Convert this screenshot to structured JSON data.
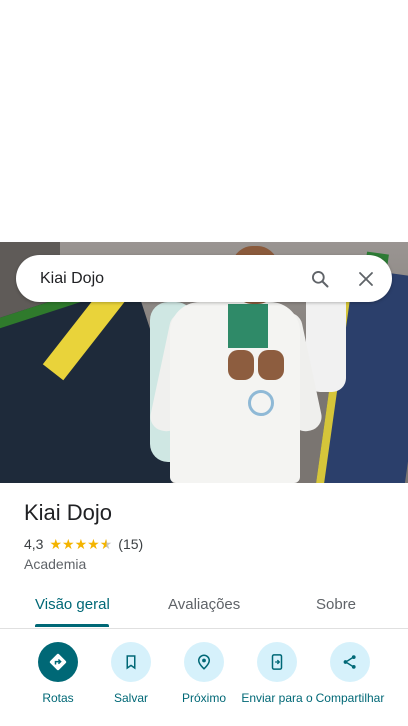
{
  "search": {
    "query": "Kiai Dojo"
  },
  "place": {
    "name": "Kiai Dojo",
    "rating": "4,3",
    "rating_value": 4.3,
    "reviews_count": "(15)",
    "category": "Academia"
  },
  "tabs": [
    {
      "label": "Visão geral"
    },
    {
      "label": "Avaliações"
    },
    {
      "label": "Sobre"
    }
  ],
  "actions": [
    {
      "label": "Rotas",
      "icon": "directions-icon"
    },
    {
      "label": "Salvar",
      "icon": "bookmark-icon"
    },
    {
      "label": "Próximo",
      "icon": "nearby-icon"
    },
    {
      "label": "Enviar para o",
      "icon": "send-to-phone-icon"
    },
    {
      "label": "Compartilhar",
      "icon": "share-icon"
    }
  ],
  "colors": {
    "accent": "#006876",
    "action_bg": "#d6f1fb",
    "star": "#f4b400"
  }
}
